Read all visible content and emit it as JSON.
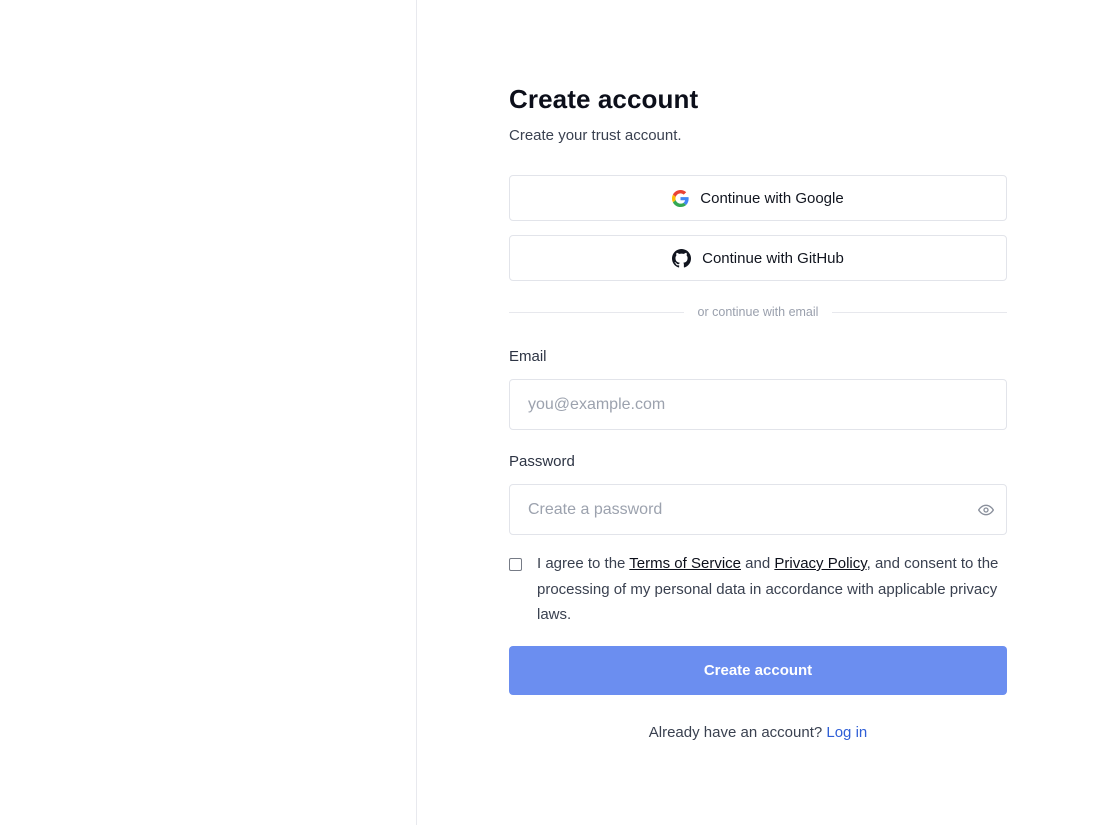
{
  "form": {
    "title": "Create account",
    "subtitle": "Create your trust account.",
    "google_label": "Continue with Google",
    "github_label": "Continue with GitHub",
    "divider_text": "or continue with email",
    "email_label": "Email",
    "email_placeholder": "you@example.com",
    "email_value": "",
    "password_label": "Password",
    "password_placeholder": "Create a password",
    "password_value": "",
    "agree_prefix": "I agree to the ",
    "terms_link": "Terms of Service",
    "agree_and": " and ",
    "privacy_link": "Privacy Policy",
    "agree_suffix": ", and consent to the processing of my personal data in accordance with applicable privacy laws.",
    "agree_checked": false,
    "submit_label": "Create account",
    "login_prompt": "Already have an account? ",
    "login_link": "Log in"
  },
  "icons": {
    "google": "google-icon",
    "github": "github-icon",
    "eye": "eye-icon"
  },
  "colors": {
    "primary_button": "#6b8ef0",
    "link": "#2f5fd6",
    "border": "#e2e4ea"
  }
}
